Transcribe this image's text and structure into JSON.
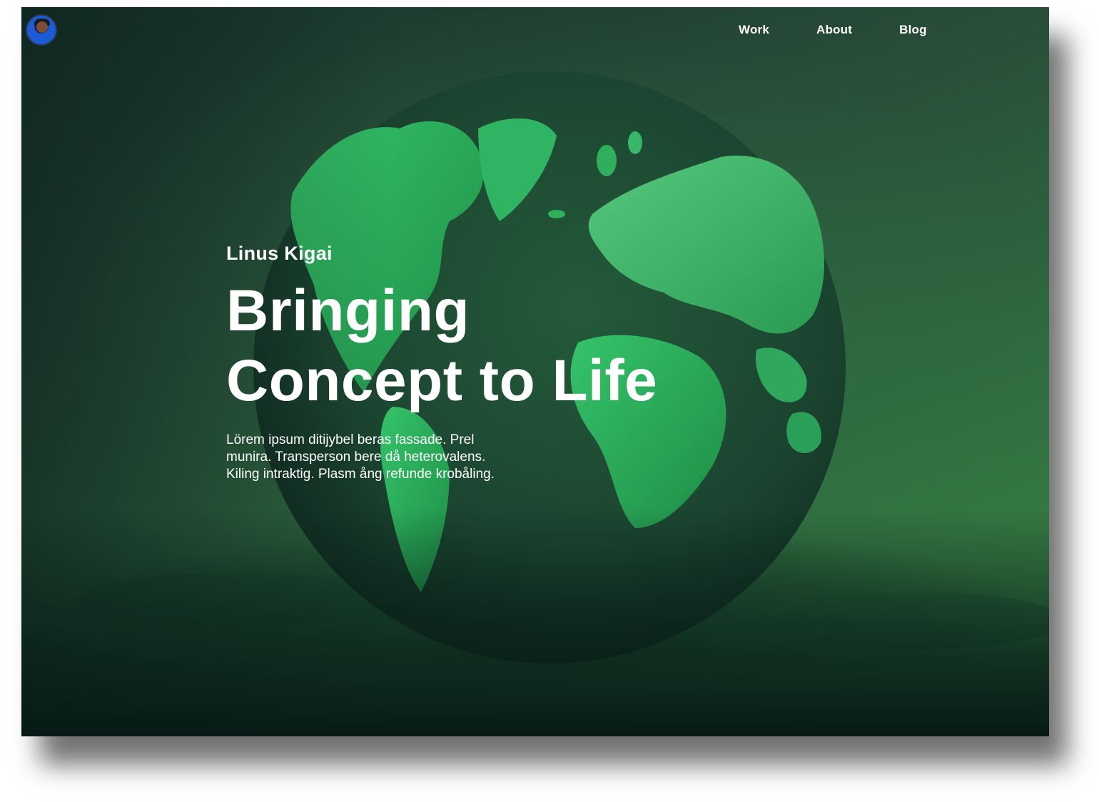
{
  "nav": {
    "avatar_alt": "profile avatar",
    "items": [
      {
        "label": "Work"
      },
      {
        "label": "About"
      },
      {
        "label": "Blog"
      }
    ]
  },
  "hero": {
    "name": "Linus Kigai",
    "headline_line1": "Bringing",
    "headline_line2": "Concept to Life",
    "description": "Lörem ipsum ditijybel beras fassade. Prel munira. Transperson bere då heterovalens. Kiling intraktig. Plasm ång refunde krobåling."
  },
  "colors": {
    "background_dark": "#17322a",
    "background_light": "#3c8a46",
    "globe_base": "#1d4a32",
    "land": "#2fae5d",
    "text": "#ffffff"
  }
}
